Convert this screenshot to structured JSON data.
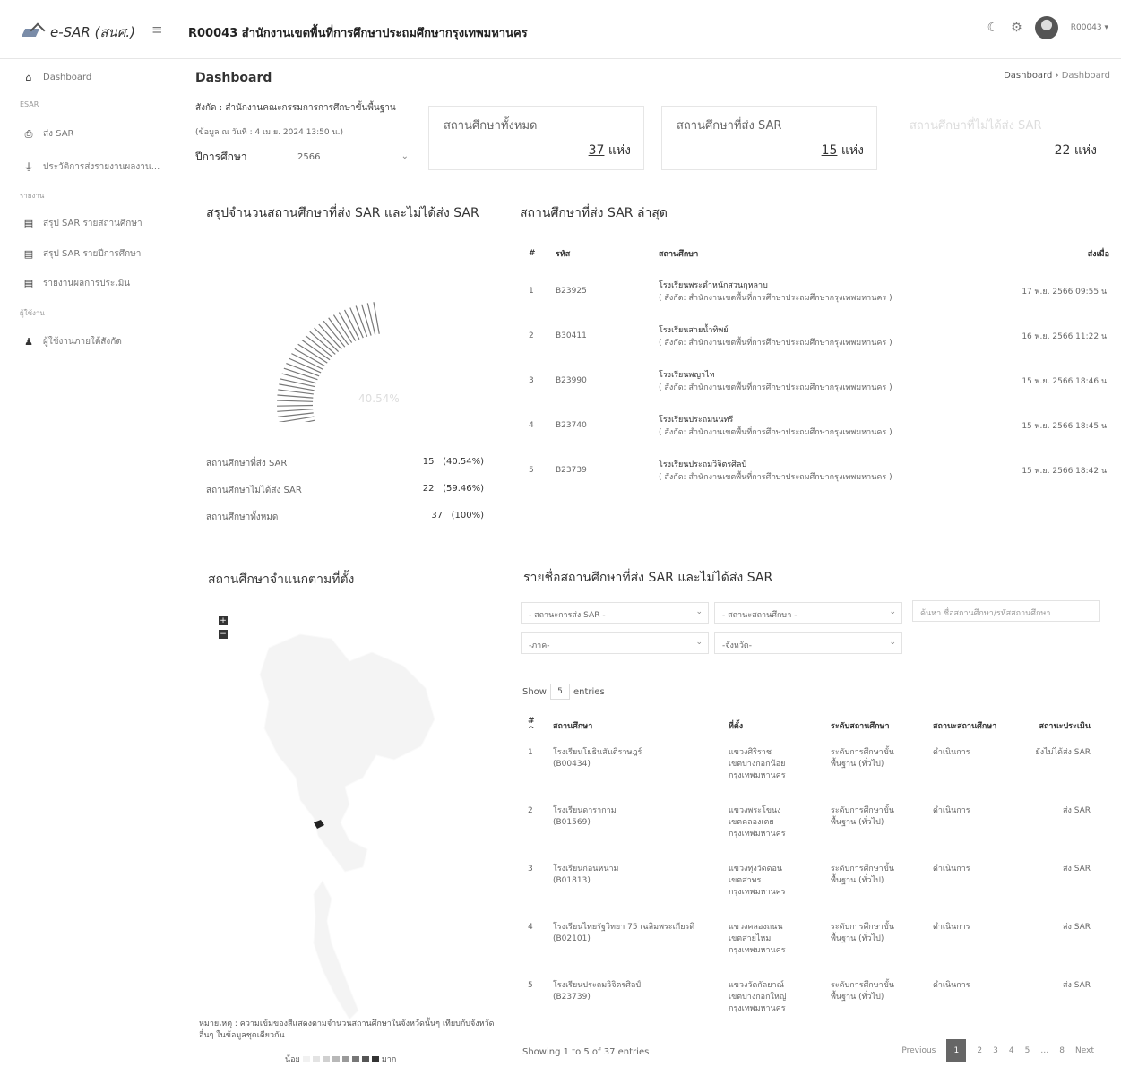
{
  "header": {
    "brand": "e-SAR (สนศ.)",
    "org_title": "R00043 สำนักงานเขตพื้นที่การศึกษาประถมศึกษากรุงเทพมหานคร",
    "user": "R00043 ▾"
  },
  "sidebar": {
    "dashboard": "Dashboard",
    "section_esar": "ESAR",
    "send_sar": "ส่ง SAR",
    "history": "ประวัติการส่งรายงานผลงาน...",
    "section_report": "รายงาน",
    "report_school": "สรุป SAR รายสถานศึกษา",
    "report_year": "สรุป SAR รายปีการศึกษา",
    "report_eval": "รายงานผลการประเมิน",
    "section_admin": "ผู้ใช้งาน",
    "users": "ผู้ใช้งานภายใต้สังกัด"
  },
  "page": {
    "title": "Dashboard",
    "breadcrumb_1": "Dashboard",
    "breadcrumb_sep": "›",
    "breadcrumb_2": "Dashboard",
    "affiliation": "สังกัด : สำนักงานคณะกรรมการการศึกษาขั้นพื้นฐาน",
    "as_of": "(ข้อมูล ณ วันที่ : 4 เม.ย. 2024 13:50 น.)",
    "year_label": "ปีการศึกษา",
    "year_value": "2566"
  },
  "cards": [
    {
      "title": "สถานศึกษาทั้งหมด",
      "value": "37",
      "unit": "แห่ง"
    },
    {
      "title": "สถานศึกษาที่ส่ง SAR",
      "value": "15",
      "unit": "แห่ง"
    },
    {
      "title": "สถานศึกษาที่ไม่ได้ส่ง SAR",
      "value": "22",
      "unit": "แห่ง"
    }
  ],
  "summary_section": {
    "title": "สรุปจำนวนสถานศึกษาที่ส่ง SAR และไม่ได้ส่ง SAR",
    "donut_label": "40.54%",
    "rows": [
      {
        "label": "สถานศึกษาที่ส่ง SAR",
        "value": "15",
        "pct": "(40.54%)"
      },
      {
        "label": "สถานศึกษาไม่ได้ส่ง SAR",
        "value": "22",
        "pct": "(59.46%)"
      },
      {
        "label": "สถานศึกษาทั้งหมด",
        "value": "37",
        "pct": "(100%)"
      }
    ],
    "sent_fraction": 0.4054
  },
  "recent": {
    "title": "สถานศึกษาที่ส่ง SAR ล่าสุด",
    "columns": [
      "#",
      "รหัส",
      "สถานศึกษา",
      "ส่งเมื่อ"
    ],
    "rows": [
      {
        "no": "1",
        "code": "B23925",
        "name": "โรงเรียนพระตำหนักสวนกุหลาบ",
        "org": "( สังกัด: สำนักงานเขตพื้นที่การศึกษาประถมศึกษากรุงเทพมหานคร )",
        "date": "17 พ.ย. 2566 09:55 น."
      },
      {
        "no": "2",
        "code": "B30411",
        "name": "โรงเรียนสายน้ำทิพย์",
        "org": "( สังกัด: สำนักงานเขตพื้นที่การศึกษาประถมศึกษากรุงเทพมหานคร )",
        "date": "16 พ.ย. 2566 11:22 น."
      },
      {
        "no": "3",
        "code": "B23990",
        "name": "โรงเรียนพญาไท",
        "org": "( สังกัด: สำนักงานเขตพื้นที่การศึกษาประถมศึกษากรุงเทพมหานคร )",
        "date": "15 พ.ย. 2566 18:46 น."
      },
      {
        "no": "4",
        "code": "B23740",
        "name": "โรงเรียนประถมนนทรี",
        "org": "( สังกัด: สำนักงานเขตพื้นที่การศึกษาประถมศึกษากรุงเทพมหานคร )",
        "date": "15 พ.ย. 2566 18:45 น."
      },
      {
        "no": "5",
        "code": "B23739",
        "name": "โรงเรียนประถมวิจิตรศิลป์",
        "org": "( สังกัด: สำนักงานเขตพื้นที่การศึกษาประถมศึกษากรุงเทพมหานคร )",
        "date": "15 พ.ย. 2566 18:42 น."
      }
    ]
  },
  "map_section": {
    "title": "สถานศึกษาจำแนกตามที่ตั้ง",
    "zoom_in": "+",
    "zoom_out": "−",
    "note": "หมายเหตุ : ความเข้มของสีแสดงตามจำนวนสถานศึกษาในจังหวัดนั้นๆ เทียบกับจังหวัดอื่นๆ ในข้อมูลชุดเดียวกัน",
    "legend_low": "น้อย",
    "legend_high": "มาก"
  },
  "list_section": {
    "title": "รายชื่อสถานศึกษาที่ส่ง SAR และไม่ได้ส่ง SAR",
    "filter_status": "- สถานะการส่ง SAR -",
    "filter_school_status": "- สถานะสถานศึกษา -",
    "search_placeholder": "ค้นหา ชื่อสถานศึกษา/รหัสสถานศึกษา",
    "filter_region": "-ภาค-",
    "filter_province": "-จังหวัด-",
    "show_label": "Show",
    "show_value": "5",
    "entries_label": "entries",
    "columns": [
      "# ^",
      "สถานศึกษา",
      "ที่ตั้ง",
      "ระดับสถานศึกษา",
      "สถานะสถานศึกษา",
      "สถานะประเมิน"
    ],
    "rows": [
      {
        "no": "1",
        "name": "โรงเรียนโยธินสันติราษฎร์",
        "code": "(B00434)",
        "loc1": "แขวงศิริราช",
        "loc2": "เขตบางกอกน้อย",
        "loc3": "กรุงเทพมหานคร",
        "level1": "ระดับการศึกษาขั้น",
        "level2": "พื้นฐาน (ทั่วไป)",
        "status": "ดำเนินการ",
        "eval": "ยังไม่ได้ส่ง SAR"
      },
      {
        "no": "2",
        "name": "โรงเรียนดารากาม",
        "code": "(B01569)",
        "loc1": "แขวงพระโขนง",
        "loc2": "เขตคลองเตย",
        "loc3": "กรุงเทพมหานคร",
        "level1": "ระดับการศึกษาขั้น",
        "level2": "พื้นฐาน (ทั่วไป)",
        "status": "ดำเนินการ",
        "eval": "ส่ง SAR"
      },
      {
        "no": "3",
        "name": "โรงเรียนก่อนหนาม",
        "code": "(B01813)",
        "loc1": "แขวงทุ่งวัดดอน",
        "loc2": "เขตสาทร",
        "loc3": "กรุงเทพมหานคร",
        "level1": "ระดับการศึกษาขั้น",
        "level2": "พื้นฐาน (ทั่วไป)",
        "status": "ดำเนินการ",
        "eval": "ส่ง SAR"
      },
      {
        "no": "4",
        "name": "โรงเรียนไทยรัฐวิทยา 75 เฉลิมพระเกียรติ",
        "code": "(B02101)",
        "loc1": "แขวงคลองถนน",
        "loc2": "เขตสายไหม",
        "loc3": "กรุงเทพมหานคร",
        "level1": "ระดับการศึกษาขั้น",
        "level2": "พื้นฐาน (ทั่วไป)",
        "status": "ดำเนินการ",
        "eval": "ส่ง SAR"
      },
      {
        "no": "5",
        "name": "โรงเรียนประถมวิจิตรศิลป์",
        "code": "(B23739)",
        "loc1": "แขวงวัดกัลยาณ์",
        "loc2": "เขตบางกอกใหญ่",
        "loc3": "กรุงเทพมหานคร",
        "level1": "ระดับการศึกษาขั้น",
        "level2": "พื้นฐาน (ทั่วไป)",
        "status": "ดำเนินการ",
        "eval": "ส่ง SAR"
      }
    ],
    "info": "Showing 1 to 5 of 37 entries",
    "pager": {
      "prev": "Previous",
      "pages": [
        "1",
        "2",
        "3",
        "4",
        "5",
        "…",
        "8"
      ],
      "next": "Next"
    }
  }
}
